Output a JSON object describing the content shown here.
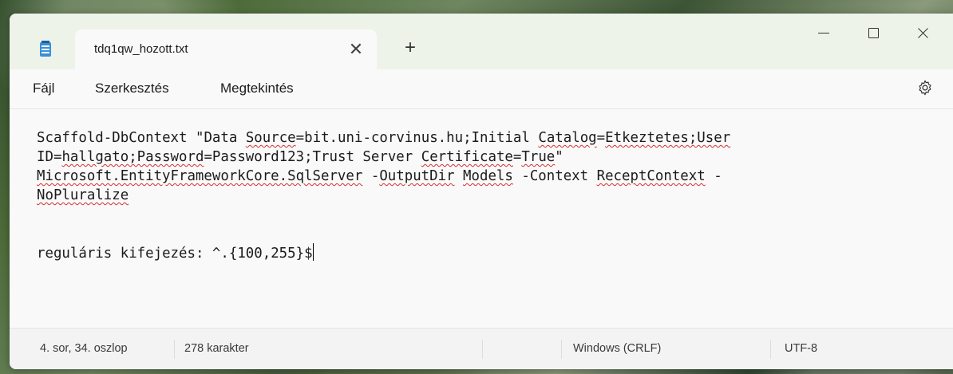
{
  "window": {
    "tab_title": "tdq1qw_hozott.txt",
    "tab_close_glyph": "✕",
    "new_tab_glyph": "+"
  },
  "menu": {
    "items": [
      "Fájl",
      "Szerkesztés",
      "Megtekintés"
    ],
    "settings_icon": "gear-icon"
  },
  "editor": {
    "lines": [
      "Scaffold-DbContext \"Data Source=bit.uni-corvinus.hu;Initial Catalog=Etkeztetes;User",
      "ID=hallgato;Password=Password123;Trust Server Certificate=True\"",
      "Microsoft.EntityFrameworkCore.SqlServer -OutputDir Models -Context ReceptContext -",
      "NoPluralize",
      "",
      "",
      "reguláris kifejezés: ^.{100,255}$"
    ]
  },
  "status": {
    "position": "4. sor, 34. oszlop",
    "char_count": "278 karakter",
    "line_ending": "Windows (CRLF)",
    "encoding": "UTF-8"
  },
  "colors": {
    "accent": "#3a8fd6",
    "spellcheck": "#d32f2f",
    "titlebar": "#eef3ea",
    "editor_bg": "#f9f9f9"
  }
}
